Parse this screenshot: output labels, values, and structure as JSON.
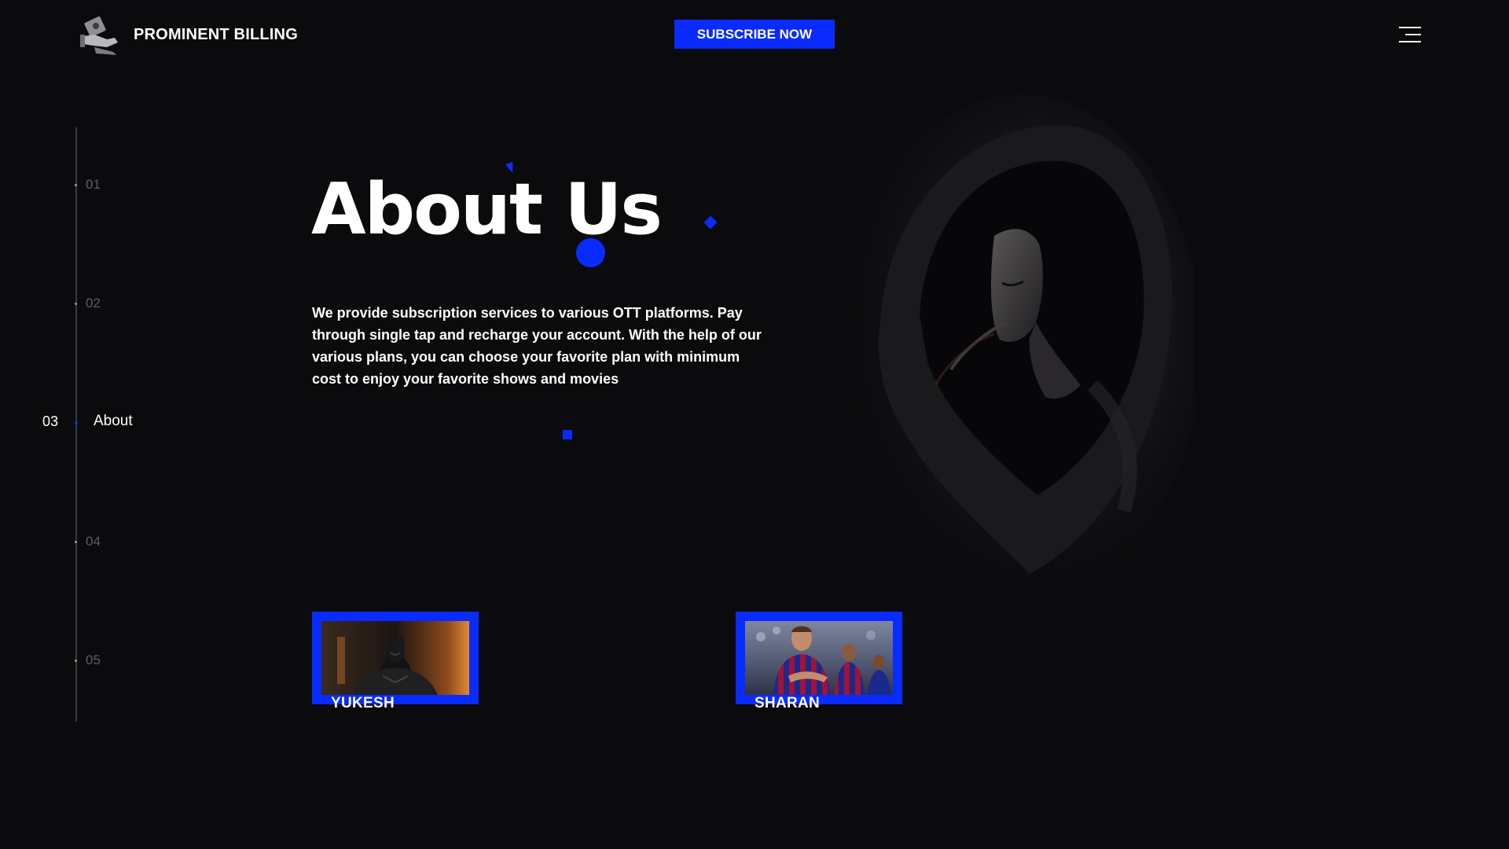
{
  "header": {
    "brand_name": "PROMINENT BILLING",
    "logo_icon": "hand-money-icon",
    "subscribe_label": "SUBSCRIBE NOW",
    "menu_icon": "hamburger-menu-icon"
  },
  "pager": {
    "items": [
      {
        "num": "01"
      },
      {
        "num": "02"
      },
      {
        "num": "03",
        "label": "About",
        "active": true
      },
      {
        "num": "04"
      },
      {
        "num": "05"
      }
    ]
  },
  "about": {
    "title": "About Us",
    "description": "We provide subscription services to various OTT platforms. Pay through single tap and recharge your account. With the help of our various plans, you can choose your favorite plan with minimum cost to enjoy your favorite shows and movies"
  },
  "team": [
    {
      "name": "YUKESH",
      "image": "batman-character-photo"
    },
    {
      "name": "SHARAN",
      "image": "footballer-photo"
    }
  ],
  "colors": {
    "background": "#0b0a0c",
    "accent": "#0a2bff",
    "text": "#ffffff",
    "muted": "#5e5e63"
  }
}
